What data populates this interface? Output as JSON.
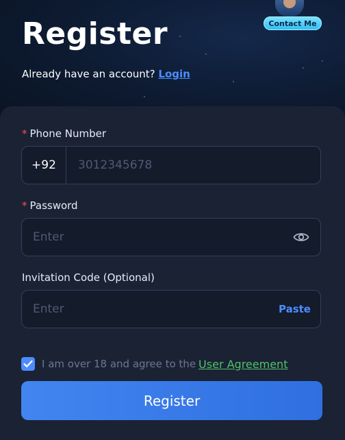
{
  "header": {
    "title": "Register",
    "subtitle_text": "Already have an account?",
    "login_link": "Login",
    "contact_button": "Contact Me"
  },
  "form": {
    "phone": {
      "label": "Phone Number",
      "required_mark": "*",
      "country_code": "+92",
      "placeholder": "3012345678",
      "value": ""
    },
    "password": {
      "label": "Password",
      "required_mark": "*",
      "placeholder": "Enter",
      "value": "",
      "toggle_icon": "eye-icon"
    },
    "invitation": {
      "label": "Invitation Code (Optional)",
      "placeholder": "Enter",
      "value": "",
      "paste_label": "Paste"
    },
    "agreement": {
      "checked": true,
      "text": "I am over 18 and agree to the",
      "link": "User Agreement"
    },
    "submit_label": "Register"
  },
  "colors": {
    "accent": "#4d8cff",
    "agreement_link": "#4fc36a",
    "required": "#ff4d4f",
    "card_bg": "#1a2234",
    "page_bg": "#0b1526"
  }
}
